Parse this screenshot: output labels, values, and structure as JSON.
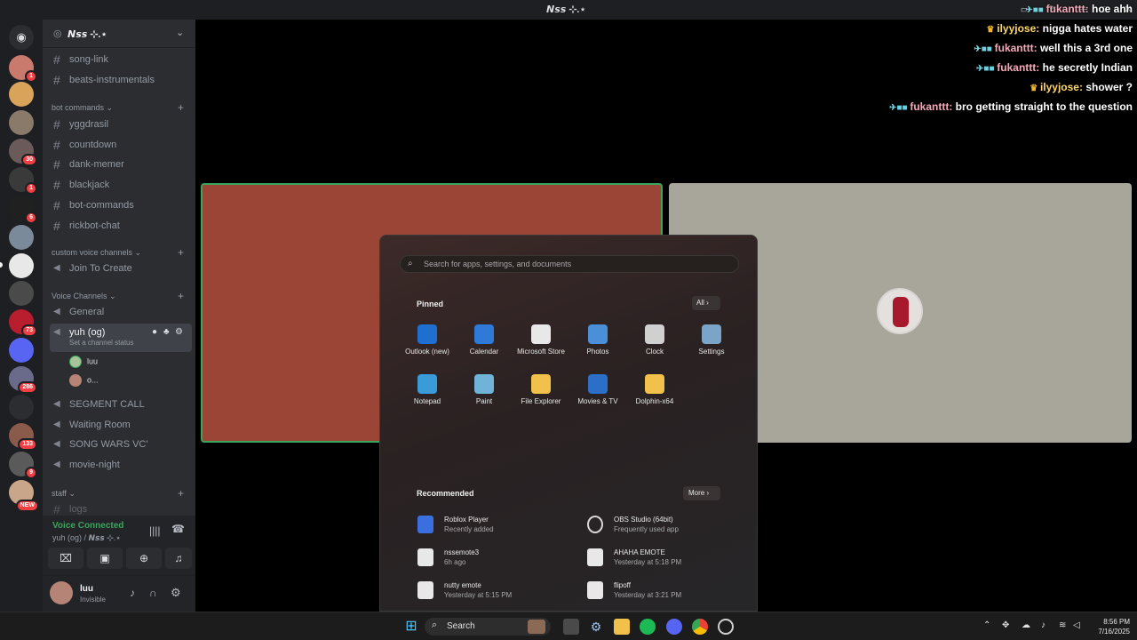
{
  "window": {
    "title": "𝙉𝙨𝙨 ⊹.⋆"
  },
  "guild": {
    "name": "𝙉𝙨𝙨 ⊹.⋆"
  },
  "servers": [
    {
      "badge": "1"
    },
    {
      "badge": ""
    },
    {
      "badge": ""
    },
    {
      "badge": "30"
    },
    {
      "badge": "1"
    },
    {
      "badge": "6"
    },
    {
      "badge": ""
    },
    {
      "badge": ""
    },
    {
      "badge": ""
    },
    {
      "badge": "73"
    },
    {
      "badge": ""
    },
    {
      "badge": "286"
    },
    {
      "badge": ""
    },
    {
      "badge": "133"
    },
    {
      "badge": "9"
    },
    {
      "badge": "NEW"
    }
  ],
  "sidebar": {
    "top_channels": [
      "song-link",
      "beats-instrumentals"
    ],
    "cat_bot": "bot commands",
    "bot_channels": [
      "yggdrasil",
      "countdown",
      "dank-memer",
      "blackjack",
      "bot-commands",
      "rickbot-chat"
    ],
    "cat_custom": "custom voice channels",
    "custom_channels": [
      "Join To Create"
    ],
    "cat_voice": "Voice Channels",
    "voice_channels": [
      "General",
      "yuh (og)"
    ],
    "channel_status": "Set a channel status",
    "voice_users": [
      "luu",
      "o..."
    ],
    "more_voice": [
      "SEGMENT CALL",
      "Waiting Room",
      "SONG WARS VC'",
      "movie-night"
    ],
    "cat_staff": "staff",
    "staff_channels": [
      "logs"
    ]
  },
  "voice_panel": {
    "status": "Voice Connected",
    "location": "yuh (og) / 𝙉𝙨𝙨 ⊹.⋆"
  },
  "user_panel": {
    "name": "luu",
    "status": "Invisible"
  },
  "chat": [
    {
      "user": "fukanttt:",
      "msg": "hoe ahh",
      "color": "#f5a9b8"
    },
    {
      "user": "ilyyjose:",
      "msg": "nigga hates water",
      "color": "#ffd66b"
    },
    {
      "user": "fukanttt:",
      "msg": "well this a 3rd one",
      "color": "#f5a9b8"
    },
    {
      "user": "fukanttt:",
      "msg": "he secretly Indian",
      "color": "#f5a9b8"
    },
    {
      "user": "ilyyjose:",
      "msg": "shower ?",
      "color": "#ffd66b"
    },
    {
      "user": "fukanttt:",
      "msg": "bro getting straight to the question",
      "color": "#f5a9b8"
    }
  ],
  "start_menu": {
    "search_placeholder": "Search for apps, settings, and documents",
    "pinned_label": "Pinned",
    "all_label": "All",
    "pinned": [
      {
        "name": "Outlook (new)",
        "color": "#1f6fd1"
      },
      {
        "name": "Calendar",
        "color": "#2f7ad9"
      },
      {
        "name": "Microsoft Store",
        "color": "#e8e8e8"
      },
      {
        "name": "Photos",
        "color": "#4a90d9"
      },
      {
        "name": "Clock",
        "color": "#d0d0d0"
      },
      {
        "name": "Settings",
        "color": "#7aa4c8"
      },
      {
        "name": "Notepad",
        "color": "#3a9bd9"
      },
      {
        "name": "Paint",
        "color": "#6fb3d8"
      },
      {
        "name": "File Explorer",
        "color": "#f2c14b"
      },
      {
        "name": "Movies & TV",
        "color": "#2b6fc9"
      },
      {
        "name": "Dolphin-x64",
        "color": "#f2c14b"
      }
    ],
    "recommended_label": "Recommended",
    "more_label": "More",
    "recommended": [
      {
        "name": "Roblox Player",
        "sub": "Recently added"
      },
      {
        "name": "OBS Studio (64bit)",
        "sub": "Frequently used app"
      },
      {
        "name": "nssemote3",
        "sub": "6h ago"
      },
      {
        "name": "AHAHA EMOTE",
        "sub": "Yesterday at 5:18 PM"
      },
      {
        "name": "nutty emote",
        "sub": "Yesterday at 5:15 PM"
      },
      {
        "name": "flipoff",
        "sub": "Yesterday at 3:21 PM"
      }
    ]
  },
  "taskbar": {
    "search_label": "Search",
    "time": "8:56 PM",
    "date": "7/16/2025"
  }
}
